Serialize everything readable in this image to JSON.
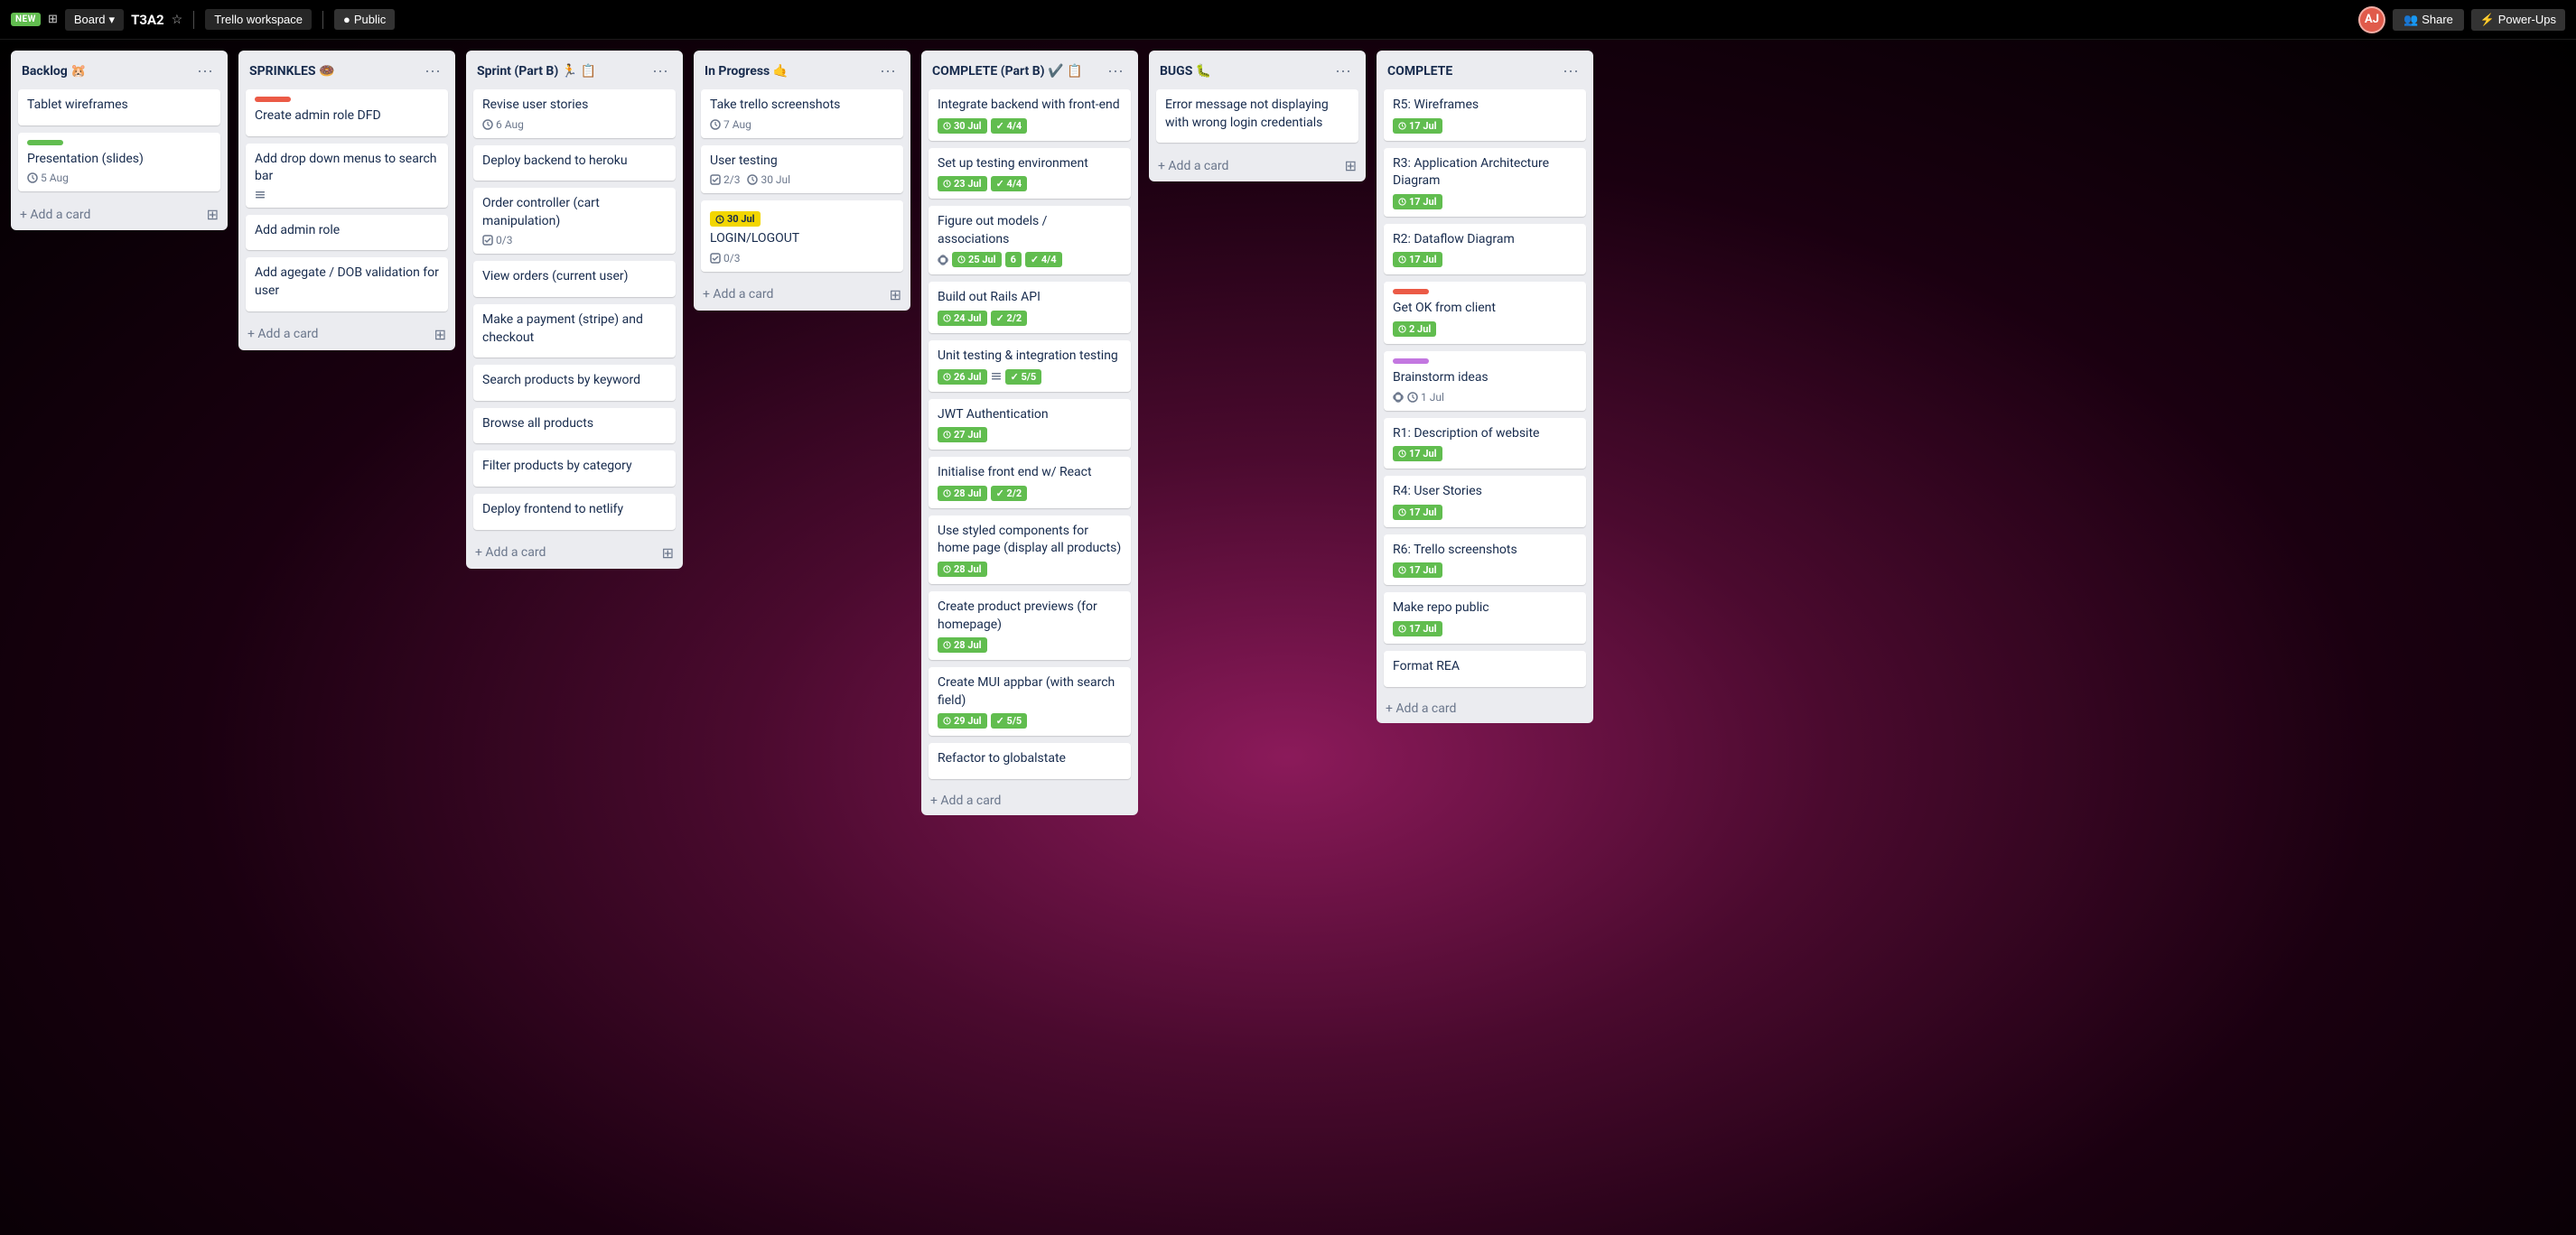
{
  "header": {
    "badge": "NEW",
    "board_icon": "⊞",
    "board_name": "Board",
    "board_name_label": "T3A2",
    "star_icon": "☆",
    "workspace_label": "Trello workspace",
    "visibility_icon": "●",
    "visibility_label": "Public",
    "avatar_label": "AJ",
    "share_icon": "👥",
    "share_label": "Share",
    "power_ups_icon": "⚡",
    "power_ups_label": "Power-Ups"
  },
  "colors": {
    "green": "#61bd4f",
    "yellow": "#f2d600",
    "red": "#eb5a46",
    "purple": "#c377e0",
    "blue": "#0079bf",
    "pink": "#ff78cb"
  },
  "lists": [
    {
      "id": "backlog",
      "title": "Backlog 🐹",
      "cards": [
        {
          "id": "b1",
          "label_color": null,
          "label_bar": null,
          "title": "Tablet wireframes",
          "meta": []
        },
        {
          "id": "b2",
          "label_bar": "#61bd4f",
          "title": "Presentation (slides)",
          "meta": [
            {
              "icon": "clock",
              "text": "5 Aug"
            }
          ]
        }
      ],
      "add_label": "+ Add a card"
    },
    {
      "id": "sprinkles",
      "title": "SPRINKLES 🍩",
      "cards": [
        {
          "id": "s0",
          "label_bar": "#eb5a46",
          "separator": true,
          "title": "Create admin role DFD",
          "meta": []
        },
        {
          "id": "s1",
          "label_bar": null,
          "title": "Add drop down menus to search bar",
          "meta": [
            {
              "icon": "list",
              "text": ""
            }
          ]
        },
        {
          "id": "s2",
          "label_bar": null,
          "title": "Add admin role",
          "meta": []
        },
        {
          "id": "s3",
          "label_bar": null,
          "title": "Add agegate / DOB validation for user",
          "meta": []
        }
      ],
      "add_label": "+ Add a card"
    },
    {
      "id": "sprint-b",
      "title": "Sprint (Part B) 🏃 📋",
      "cards": [
        {
          "id": "sp1",
          "title": "Revise user stories",
          "meta": [
            {
              "icon": "clock",
              "text": "6 Aug"
            }
          ]
        },
        {
          "id": "sp2",
          "title": "Deploy backend to heroku",
          "meta": []
        },
        {
          "id": "sp3",
          "title": "Order controller (cart manipulation)",
          "meta": [
            {
              "icon": "check",
              "text": "0/3"
            }
          ]
        },
        {
          "id": "sp4",
          "title": "View orders (current user)",
          "meta": []
        },
        {
          "id": "sp5",
          "title": "Make a payment (stripe) and checkout",
          "meta": []
        },
        {
          "id": "sp6",
          "title": "Search products by keyword",
          "meta": []
        },
        {
          "id": "sp7",
          "title": "Browse all products",
          "meta": []
        },
        {
          "id": "sp8",
          "title": "Filter products by category",
          "meta": []
        },
        {
          "id": "sp9",
          "title": "Deploy frontend to netlify",
          "meta": []
        }
      ],
      "add_label": "+ Add a card"
    },
    {
      "id": "in-progress",
      "title": "In Progress 🤙",
      "cards": [
        {
          "id": "ip1",
          "title": "Take trello screenshots",
          "meta": [
            {
              "icon": "clock",
              "text": "7 Aug"
            }
          ]
        },
        {
          "id": "ip2",
          "title": "User testing",
          "meta": [
            {
              "icon": "check",
              "text": "2/3"
            },
            {
              "icon": "clock",
              "text": "30 Jul"
            }
          ]
        },
        {
          "id": "ip3",
          "label_bar": "#f2d600",
          "title": "LOGIN/LOGOUT",
          "meta": [
            {
              "icon": "badge-yellow",
              "text": "30 Jul"
            },
            {
              "icon": "check",
              "text": "0/3"
            }
          ]
        }
      ],
      "add_label": "+ Add a card"
    },
    {
      "id": "complete-b",
      "title": "COMPLETE (Part B) ✔️ 📋",
      "cards": [
        {
          "id": "cb1",
          "title": "Integrate backend with front-end",
          "badges": [
            {
              "color": "green",
              "text": "30 Jul"
            },
            {
              "color": "green",
              "text": "4/4"
            }
          ]
        },
        {
          "id": "cb2",
          "title": "Set up testing environment",
          "badges": [
            {
              "color": "green",
              "text": "23 Jul"
            },
            {
              "color": "green",
              "text": "4/4"
            }
          ]
        },
        {
          "id": "cb3",
          "title": "Figure out models / associations",
          "badges": [
            {
              "color": "green",
              "text": "25 Jul"
            },
            {
              "color": "green",
              "text": "6"
            },
            {
              "color": "green",
              "text": "4/4"
            }
          ],
          "has_eye": true
        },
        {
          "id": "cb4",
          "title": "Build out Rails API",
          "badges": [
            {
              "color": "green",
              "text": "24 Jul"
            },
            {
              "color": "green",
              "text": "2/2"
            }
          ]
        },
        {
          "id": "cb5",
          "title": "Unit testing & integration testing",
          "badges": [
            {
              "color": "green",
              "text": "26 Jul"
            },
            {
              "color": "green",
              "text": "5/5"
            }
          ],
          "has_list": true
        },
        {
          "id": "cb6",
          "title": "JWT Authentication",
          "badges": [
            {
              "color": "green",
              "text": "27 Jul"
            }
          ]
        },
        {
          "id": "cb7",
          "title": "Initialise front end w/ React",
          "badges": [
            {
              "color": "green",
              "text": "28 Jul"
            },
            {
              "color": "green",
              "text": "2/2"
            }
          ]
        },
        {
          "id": "cb8",
          "title": "Use styled components for home page (display all products)",
          "badges": [
            {
              "color": "green",
              "text": "28 Jul"
            }
          ]
        },
        {
          "id": "cb9",
          "title": "Create product previews (for homepage)",
          "badges": [
            {
              "color": "green",
              "text": "28 Jul"
            }
          ]
        },
        {
          "id": "cb10",
          "title": "Create MUI appbar (with search field)",
          "badges": [
            {
              "color": "green",
              "text": "29 Jul"
            },
            {
              "color": "green",
              "text": "5/5"
            }
          ]
        },
        {
          "id": "cb11",
          "title": "Refactor to globalstate",
          "badges": []
        }
      ],
      "add_label": "+ Add a card"
    },
    {
      "id": "bugs",
      "title": "BUGS 🐛",
      "cards": [
        {
          "id": "bug1",
          "title": "Error message not displaying with wrong login credentials",
          "meta": []
        }
      ],
      "add_label": "+ Add a card"
    },
    {
      "id": "complete-r",
      "title": "COMPLETE",
      "cards": [
        {
          "id": "cr1",
          "title": "R5: Wireframes",
          "badges": [
            {
              "color": "green",
              "text": "17 Jul"
            }
          ]
        },
        {
          "id": "cr2",
          "title": "R3: Application Architecture Diagram",
          "badges": [
            {
              "color": "green",
              "text": "17 Jul"
            }
          ]
        },
        {
          "id": "cr3",
          "title": "R2: Dataflow Diagram",
          "badges": [
            {
              "color": "green",
              "text": "17 Jul"
            }
          ]
        },
        {
          "id": "cr4",
          "label_bar": "#eb5a46",
          "title": "Get OK from client",
          "badges": [
            {
              "color": "green",
              "text": "2 Jul"
            }
          ]
        },
        {
          "id": "cr5",
          "label_bar": "#c377e0",
          "title": "Brainstorm ideas",
          "meta": [
            {
              "icon": "eye"
            },
            {
              "icon": "clock",
              "text": "1 Jul"
            }
          ]
        },
        {
          "id": "cr6",
          "title": "R1: Description of website",
          "badges": [
            {
              "color": "green",
              "text": "17 Jul"
            }
          ]
        },
        {
          "id": "cr7",
          "title": "R4: User Stories",
          "badges": [
            {
              "color": "green",
              "text": "17 Jul"
            }
          ]
        },
        {
          "id": "cr8",
          "title": "R6: Trello screenshots",
          "badges": [
            {
              "color": "green",
              "text": "17 Jul"
            }
          ]
        },
        {
          "id": "cr9",
          "title": "Make repo public",
          "badges": [
            {
              "color": "green",
              "text": "17 Jul"
            }
          ]
        },
        {
          "id": "cr10",
          "title": "Format REA",
          "badges": []
        }
      ],
      "add_label": "+ Add a card"
    }
  ]
}
